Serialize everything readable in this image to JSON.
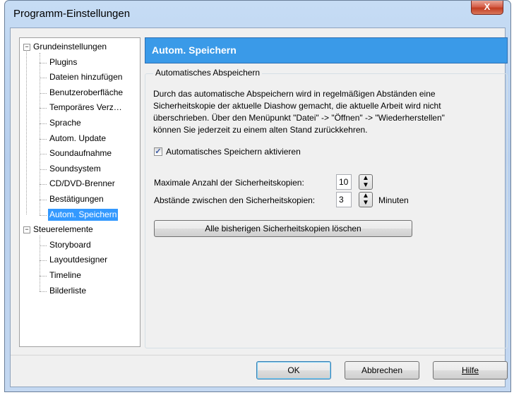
{
  "window": {
    "title": "Programm-Einstellungen",
    "close_label": "X"
  },
  "tree": {
    "groups": [
      {
        "label": "Grundeinstellungen",
        "expander": "−",
        "children": [
          "Plugins",
          "Dateien hinzufügen",
          "Benutzeroberfläche",
          "Temporäres Verz…",
          "Sprache",
          "Autom. Update",
          "Soundaufnahme",
          "Soundsystem",
          "CD/DVD-Brenner",
          "Bestätigungen",
          "Autom. Speichern"
        ]
      },
      {
        "label": "Steuerelemente",
        "expander": "−",
        "children": [
          "Storyboard",
          "Layoutdesigner",
          "Timeline",
          "Bilderliste"
        ]
      }
    ],
    "selected": "Autom. Speichern"
  },
  "panel": {
    "header": "Autom. Speichern",
    "group_label": "Automatisches Abspeichern",
    "description": [
      "Durch das automatische Abspeichern wird in regelmäßigen Abständen eine",
      "Sicherheitskopie der aktuelle Diashow gemacht, die aktuelle Arbeit wird nicht",
      "überschrieben. Über den Menüpunkt \"Datei\" -> \"Öffnen\" -> \"Wiederherstellen\"",
      "können Sie jederzeit zu einem alten Stand zurückkehren."
    ],
    "checkbox": {
      "label": "Automatisches Speichern aktivieren",
      "checked": true,
      "mark": "✓"
    },
    "max_copies": {
      "label": "Maximale Anzahl der Sicherheitskopien:",
      "value": "10"
    },
    "interval": {
      "label": "Abstände zwischen den Sicherheitskopien:",
      "value": "3",
      "unit": "Minuten"
    },
    "delete_button": "Alle bisherigen Sicherheitskopien löschen"
  },
  "footer": {
    "ok": "OK",
    "cancel": "Abbrechen",
    "help": "Hilfe"
  },
  "colors": {
    "header_bg": "#3a9ae8",
    "selection": "#3399ff"
  }
}
